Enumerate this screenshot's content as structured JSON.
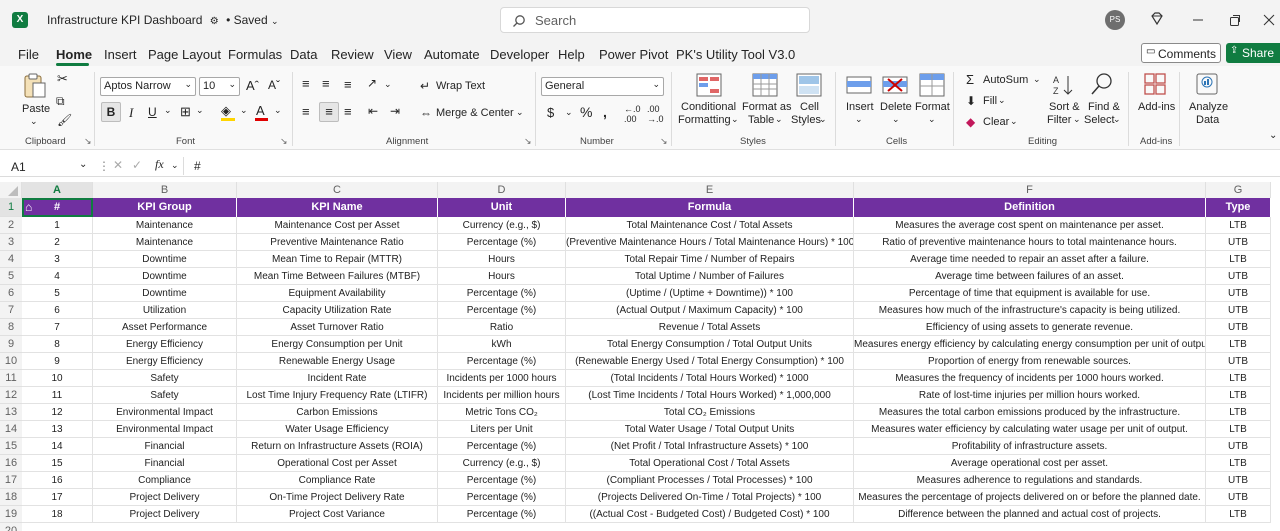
{
  "app": {
    "title": "Infrastructure KPI Dashboard",
    "saved_status": "• Saved",
    "search_placeholder": "Search",
    "avatar_initials": "PS",
    "comments_label": "Comments",
    "share_label": "Share"
  },
  "tabs": [
    "File",
    "Home",
    "Insert",
    "Page Layout",
    "Formulas",
    "Data",
    "Review",
    "View",
    "Automate",
    "Developer",
    "Help",
    "Power Pivot",
    "PK's Utility Tool V3.0"
  ],
  "ribbon": {
    "paste": "Paste",
    "clipboard": "Clipboard",
    "font_name": "Aptos Narrow",
    "font_size": "10",
    "font_group": "Font",
    "wrap_text": "Wrap Text",
    "merge_center": "Merge & Center",
    "alignment": "Alignment",
    "number_format": "General",
    "number_group": "Number",
    "cond_fmt_1": "Conditional",
    "cond_fmt_2": "Formatting",
    "fmt_table_1": "Format as",
    "fmt_table_2": "Table",
    "cell_styles_1": "Cell",
    "cell_styles_2": "Styles",
    "styles_group": "Styles",
    "insert": "Insert",
    "delete": "Delete",
    "format": "Format",
    "cells_group": "Cells",
    "autosum": "AutoSum",
    "fill": "Fill",
    "clear": "Clear",
    "sort_1": "Sort &",
    "sort_2": "Filter",
    "find_1": "Find &",
    "find_2": "Select",
    "editing_group": "Editing",
    "addins": "Add-ins",
    "addins_group": "Add-ins",
    "analyze_1": "Analyze",
    "analyze_2": "Data"
  },
  "formula_bar": {
    "name_box": "A1",
    "fx": "fx",
    "content": "#"
  },
  "columns": [
    "A",
    "B",
    "C",
    "D",
    "E",
    "F",
    "G"
  ],
  "headers": [
    "#",
    "KPI Group",
    "KPI Name",
    "Unit",
    "Formula",
    "Definition",
    "Type"
  ],
  "row_numbers": [
    "1",
    "2",
    "3",
    "4",
    "5",
    "6",
    "7",
    "8",
    "9",
    "10",
    "11",
    "12",
    "13",
    "14",
    "15",
    "16",
    "17",
    "18",
    "19",
    "20"
  ],
  "rows": [
    [
      "1",
      "Maintenance",
      "Maintenance Cost per Asset",
      "Currency (e.g., $)",
      "Total Maintenance Cost / Total Assets",
      "Measures the average cost spent on maintenance per asset.",
      "LTB"
    ],
    [
      "2",
      "Maintenance",
      "Preventive Maintenance Ratio",
      "Percentage (%)",
      "(Preventive Maintenance Hours / Total Maintenance Hours) * 100",
      "Ratio of preventive maintenance hours to total maintenance hours.",
      "UTB"
    ],
    [
      "3",
      "Downtime",
      "Mean Time to Repair (MTTR)",
      "Hours",
      "Total Repair Time / Number of Repairs",
      "Average time needed to repair an asset after a failure.",
      "LTB"
    ],
    [
      "4",
      "Downtime",
      "Mean Time Between Failures (MTBF)",
      "Hours",
      "Total Uptime / Number of Failures",
      "Average time between failures of an asset.",
      "UTB"
    ],
    [
      "5",
      "Downtime",
      "Equipment Availability",
      "Percentage (%)",
      "(Uptime / (Uptime + Downtime)) * 100",
      "Percentage of time that equipment is available for use.",
      "UTB"
    ],
    [
      "6",
      "Utilization",
      "Capacity Utilization Rate",
      "Percentage (%)",
      "(Actual Output / Maximum Capacity) * 100",
      "Measures how much of the infrastructure's capacity is being utilized.",
      "UTB"
    ],
    [
      "7",
      "Asset Performance",
      "Asset Turnover Ratio",
      "Ratio",
      "Revenue / Total Assets",
      "Efficiency of using assets to generate revenue.",
      "UTB"
    ],
    [
      "8",
      "Energy Efficiency",
      "Energy Consumption per Unit",
      "kWh",
      "Total Energy Consumption / Total Output Units",
      "Measures energy efficiency by calculating energy consumption per unit of output.",
      "LTB"
    ],
    [
      "9",
      "Energy Efficiency",
      "Renewable Energy Usage",
      "Percentage (%)",
      "(Renewable Energy Used / Total Energy Consumption) * 100",
      "Proportion of energy from renewable sources.",
      "UTB"
    ],
    [
      "10",
      "Safety",
      "Incident Rate",
      "Incidents per 1000 hours",
      "(Total Incidents / Total Hours Worked) * 1000",
      "Measures the frequency of incidents per 1000 hours worked.",
      "LTB"
    ],
    [
      "11",
      "Safety",
      "Lost Time Injury Frequency Rate (LTIFR)",
      "Incidents per million hours",
      "(Lost Time Incidents / Total Hours Worked) * 1,000,000",
      "Rate of lost-time injuries per million hours worked.",
      "LTB"
    ],
    [
      "12",
      "Environmental Impact",
      "Carbon Emissions",
      "Metric Tons CO₂",
      "Total CO₂ Emissions",
      "Measures the total carbon emissions produced by the infrastructure.",
      "LTB"
    ],
    [
      "13",
      "Environmental Impact",
      "Water Usage Efficiency",
      "Liters per Unit",
      "Total Water Usage / Total Output Units",
      "Measures water efficiency by calculating water usage per unit of output.",
      "LTB"
    ],
    [
      "14",
      "Financial",
      "Return on Infrastructure Assets (ROIA)",
      "Percentage (%)",
      "(Net Profit / Total Infrastructure Assets) * 100",
      "Profitability of infrastructure assets.",
      "UTB"
    ],
    [
      "15",
      "Financial",
      "Operational Cost per Asset",
      "Currency (e.g., $)",
      "Total Operational Cost / Total Assets",
      "Average operational cost per asset.",
      "LTB"
    ],
    [
      "16",
      "Compliance",
      "Compliance Rate",
      "Percentage (%)",
      "(Compliant Processes / Total Processes) * 100",
      "Measures adherence to regulations and standards.",
      "UTB"
    ],
    [
      "17",
      "Project Delivery",
      "On-Time Project Delivery Rate",
      "Percentage (%)",
      "(Projects Delivered On-Time / Total Projects) * 100",
      "Measures the percentage of projects delivered on or before the planned date.",
      "UTB"
    ],
    [
      "18",
      "Project Delivery",
      "Project Cost Variance",
      "Percentage (%)",
      "((Actual Cost - Budgeted Cost) / Budgeted Cost) * 100",
      "Difference between the planned and actual cost of projects.",
      "LTB"
    ]
  ]
}
